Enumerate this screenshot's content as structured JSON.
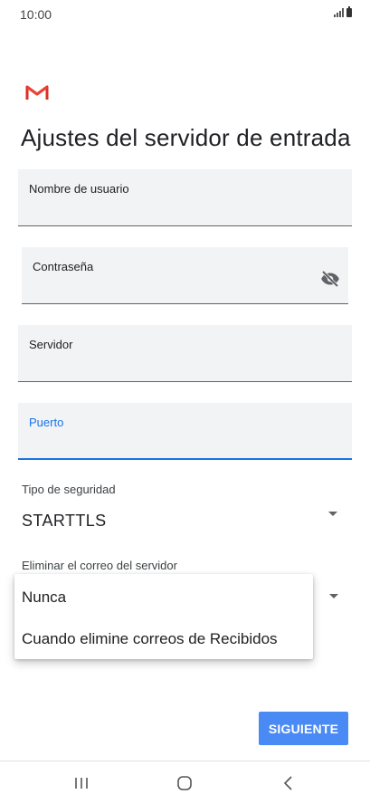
{
  "status_bar": {
    "time": "10:00"
  },
  "screen": {
    "title": "Ajustes del servidor de entrada"
  },
  "fields": {
    "username_label": "Nombre de usuario",
    "password_label": "Contraseña",
    "server_label": "Servidor",
    "port_label": "Puerto"
  },
  "security": {
    "label": "Tipo de seguridad",
    "value": "STARTTLS"
  },
  "delete_from_server": {
    "label": "Eliminar el correo del servidor",
    "options": [
      "Nunca",
      "Cuando elimine correos de Recibidos"
    ]
  },
  "actions": {
    "next_label": "SIGUIENTE"
  },
  "icons": {
    "logo": "gmail-logo",
    "password_toggle": "visibility-off-icon",
    "dropdown": "arrow-drop-down-icon",
    "nav_recents": "recents-icon",
    "nav_home": "home-icon",
    "nav_back": "back-icon"
  },
  "colors": {
    "accent": "#1a73e8",
    "button": "#4a8af4",
    "field_bg": "#f1f3f4",
    "gmail_red": "#d93025"
  }
}
